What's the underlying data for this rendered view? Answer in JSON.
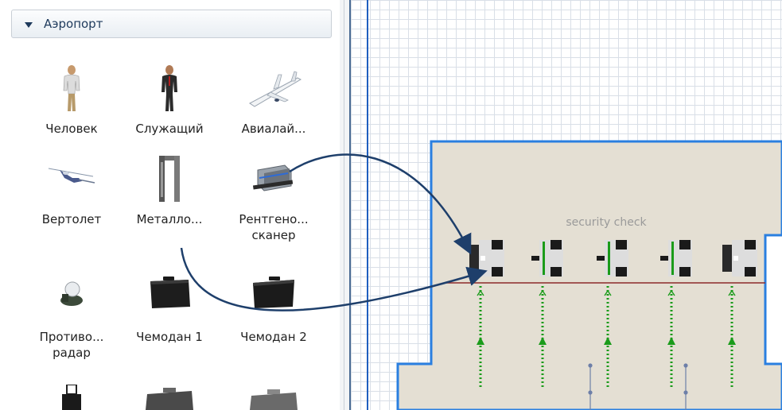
{
  "palette": {
    "section_title": "Аэропорт",
    "items": [
      {
        "label": "Человек",
        "icon": "person-icon"
      },
      {
        "label": "Служащий",
        "icon": "employee-icon"
      },
      {
        "label": "Авиалай...",
        "icon": "airliner-icon"
      },
      {
        "label": "Вертолет",
        "icon": "helicopter-icon"
      },
      {
        "label": "Металло...",
        "icon": "metal-detector-icon"
      },
      {
        "label": "Рентгено...",
        "label2": "сканер",
        "icon": "xray-scanner-icon"
      },
      {
        "label": "Противо...",
        "label2": "радар",
        "icon": "radar-icon"
      },
      {
        "label": "Чемодан 1",
        "icon": "suitcase-icon"
      },
      {
        "label": "Чемодан 2",
        "icon": "suitcase-icon"
      }
    ]
  },
  "canvas": {
    "zone_label": "security check",
    "colors": {
      "wall": "#2a7fe0",
      "floor": "#e4dfd3",
      "path": "#1a9b1a",
      "line": "#8b2a2a",
      "arrow": "#1e3f6b"
    }
  }
}
